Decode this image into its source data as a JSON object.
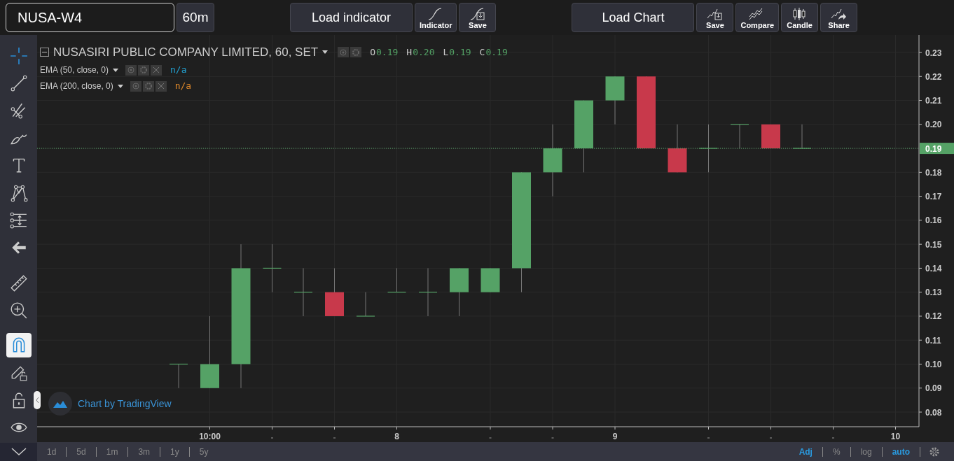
{
  "toolbar": {
    "symbol": "NUSA-W4",
    "interval": "60m",
    "groups": [
      [
        {
          "kind": "text",
          "label": "Load indicator"
        },
        {
          "kind": "indicator",
          "label": "Indicator"
        },
        {
          "kind": "save",
          "label": "Save"
        }
      ],
      [
        {
          "kind": "text",
          "label": "Load Chart"
        },
        {
          "kind": "chartsave",
          "label": "Save"
        },
        {
          "kind": "compare",
          "label": "Compare"
        },
        {
          "kind": "candle",
          "label": "Candle"
        },
        {
          "kind": "share",
          "label": "Share"
        }
      ]
    ]
  },
  "drawing_tools": [
    {
      "kind": "crosshair",
      "selected": true
    },
    {
      "kind": "line",
      "selected": false
    },
    {
      "kind": "fib",
      "selected": false
    },
    {
      "kind": "brush",
      "selected": false
    },
    {
      "kind": "text",
      "selected": false
    },
    {
      "kind": "pattern",
      "selected": false
    },
    {
      "kind": "measure",
      "selected": false
    },
    {
      "kind": "back",
      "selected": false
    },
    {
      "kind": "ruler",
      "selected": false
    },
    {
      "kind": "zoom",
      "selected": false
    },
    {
      "kind": "magnet",
      "selected": true
    },
    {
      "kind": "pencillock",
      "selected": false
    },
    {
      "kind": "lock",
      "selected": false
    },
    {
      "kind": "eye",
      "selected": false
    }
  ],
  "legend": {
    "title": "NUSASIRI PUBLIC COMPANY LIMITED, 60, SET",
    "ohlc": [
      {
        "label": "O",
        "value": "0.19"
      },
      {
        "label": "H",
        "value": "0.20"
      },
      {
        "label": "L",
        "value": "0.19"
      },
      {
        "label": "C",
        "value": "0.19"
      }
    ],
    "studies": [
      {
        "label": "EMA (50, close, 0)",
        "value": "n/a",
        "color": "#22a1d1"
      },
      {
        "label": "EMA (200, close, 0)",
        "value": "n/a",
        "color": "#e0892a"
      }
    ]
  },
  "chart": {
    "attribution": "Chart by TradingView",
    "price_labels": [
      {
        "text": "0.23",
        "highlight": false
      },
      {
        "text": "0.22",
        "highlight": false
      },
      {
        "text": "0.21",
        "highlight": false
      },
      {
        "text": "0.20",
        "highlight": false
      },
      {
        "text": "0.19",
        "highlight": true
      },
      {
        "text": "0.18",
        "highlight": false
      },
      {
        "text": "0.17",
        "highlight": false
      },
      {
        "text": "0.16",
        "highlight": false
      },
      {
        "text": "0.15",
        "highlight": false
      },
      {
        "text": "0.14",
        "highlight": false
      },
      {
        "text": "0.13",
        "highlight": false
      },
      {
        "text": "0.12",
        "highlight": false
      },
      {
        "text": "0.11",
        "highlight": false
      },
      {
        "text": "0.10",
        "highlight": false
      },
      {
        "text": "0.09",
        "highlight": false
      },
      {
        "text": "0.08",
        "highlight": false
      }
    ],
    "time_labels": [
      "10:00",
      "8",
      "9",
      "10"
    ]
  },
  "ranges": [
    "1d",
    "5d",
    "1m",
    "3m",
    "1y",
    "5y"
  ],
  "scale_options": [
    {
      "label": "Adj",
      "selected": true
    },
    {
      "label": "%",
      "selected": false
    },
    {
      "label": "log",
      "selected": false
    },
    {
      "label": "auto",
      "selected": true
    }
  ]
}
